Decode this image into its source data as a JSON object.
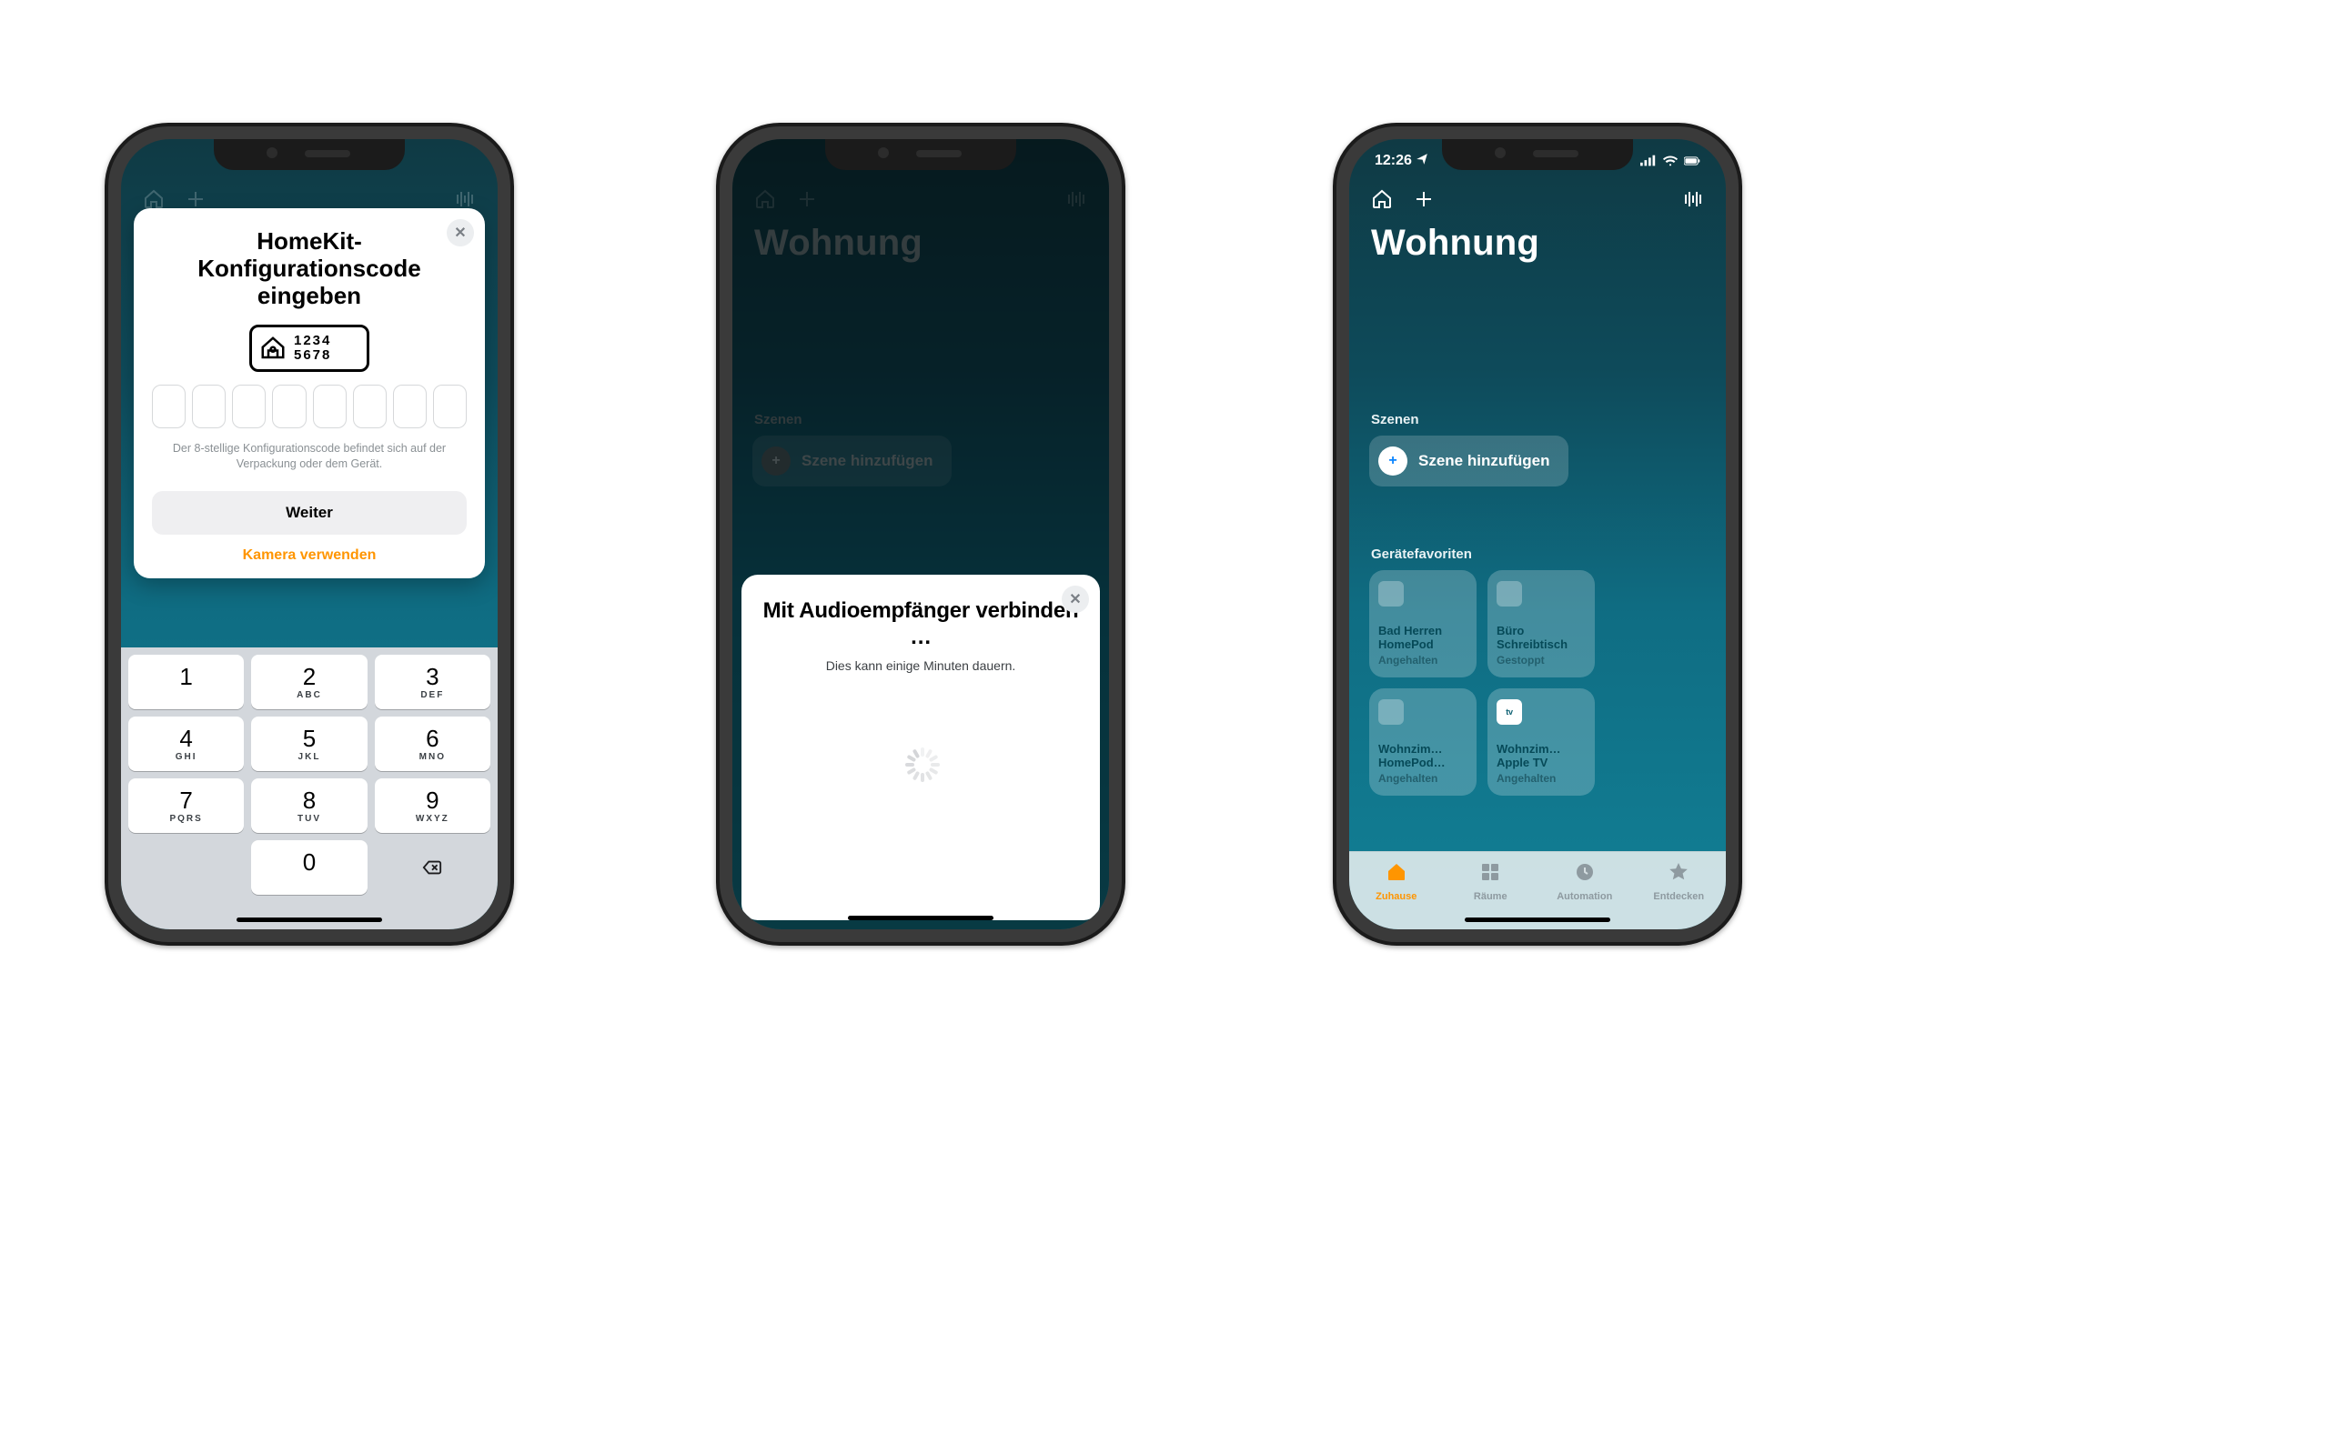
{
  "colors": {
    "accent_orange": "#ff9500",
    "teal_bg_top": "#0f3a44",
    "teal_bg_bottom": "#128096"
  },
  "phone1": {
    "modal": {
      "title": "HomeKit-Konfigurationscode eingeben",
      "badge_lines": [
        "1234",
        "5678"
      ],
      "hint": "Der 8-stellige Konfigurationscode befindet sich auf der Verpackung oder dem Gerät.",
      "primary_button": "Weiter",
      "secondary_link": "Kamera verwenden",
      "code_length": 8
    },
    "keypad": [
      {
        "n": "1",
        "l": ""
      },
      {
        "n": "2",
        "l": "ABC"
      },
      {
        "n": "3",
        "l": "DEF"
      },
      {
        "n": "4",
        "l": "GHI"
      },
      {
        "n": "5",
        "l": "JKL"
      },
      {
        "n": "6",
        "l": "MNO"
      },
      {
        "n": "7",
        "l": "PQRS"
      },
      {
        "n": "8",
        "l": "TUV"
      },
      {
        "n": "9",
        "l": "WXYZ"
      },
      {
        "blank": true
      },
      {
        "n": "0",
        "l": ""
      },
      {
        "backspace": true
      }
    ]
  },
  "phone2": {
    "home_title": "Wohnung",
    "section_scenes": "Szenen",
    "scene_pill": "Szene hinzufügen",
    "sheet": {
      "title": "Mit Audioempfän­ger verbinden …",
      "subtitle": "Dies kann einige Minuten dauern."
    }
  },
  "phone3": {
    "status": {
      "time": "12:26",
      "location_arrow": true
    },
    "home_title": "Wohnung",
    "section_scenes": "Szenen",
    "scene_pill": "Szene hinzufügen",
    "section_favs": "Gerätefavoriten",
    "tiles": [
      {
        "icon": "homepod",
        "line1": "Bad Herren",
        "line2": "HomePod",
        "status": "Angehalten"
      },
      {
        "icon": "receiver",
        "line1": "Büro",
        "line2": "Schreibtisch",
        "status": "Gestoppt"
      },
      {
        "icon": "homepod",
        "line1": "Wohnzim…",
        "line2": "HomePod…",
        "status": "Angehalten"
      },
      {
        "icon": "appletv",
        "line1": "Wohnzim…",
        "line2": "Apple TV",
        "status": "Angehalten",
        "badge": "tv"
      }
    ],
    "tabs": [
      {
        "label": "Zuhause",
        "active": true
      },
      {
        "label": "Räume",
        "active": false
      },
      {
        "label": "Automation",
        "active": false
      },
      {
        "label": "Entdecken",
        "active": false
      }
    ]
  }
}
